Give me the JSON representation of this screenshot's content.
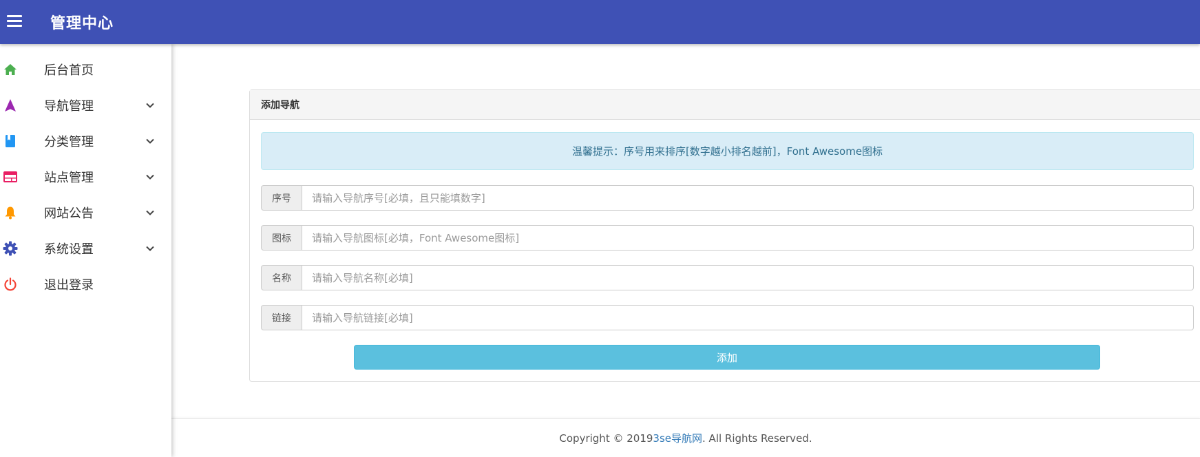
{
  "header": {
    "title": "管理中心",
    "menu_icon": "hamburger-icon",
    "bg_color": "#3f51b5"
  },
  "sidebar": {
    "items": [
      {
        "label": "后台首页",
        "icon": "home-icon",
        "icon_color": "#4caf50",
        "has_chevron": false
      },
      {
        "label": "导航管理",
        "icon": "navigation-arrow-icon",
        "icon_color": "#9c27b0",
        "has_chevron": true
      },
      {
        "label": "分类管理",
        "icon": "book-icon",
        "icon_color": "#2196f3",
        "has_chevron": true
      },
      {
        "label": "站点管理",
        "icon": "web-window-icon",
        "icon_color": "#e91e63",
        "has_chevron": true
      },
      {
        "label": "网站公告",
        "icon": "bell-icon",
        "icon_color": "#ff9800",
        "has_chevron": true
      },
      {
        "label": "系统设置",
        "icon": "gear-icon",
        "icon_color": "#3f51b5",
        "has_chevron": true
      },
      {
        "label": "退出登录",
        "icon": "power-icon",
        "icon_color": "#f44336",
        "has_chevron": false
      }
    ]
  },
  "card": {
    "title": "添加导航",
    "alert": "温馨提示：序号用来排序[数字越小排名越前]，Font Awesome图标",
    "fields": [
      {
        "label": "序号",
        "placeholder": "请输入导航序号[必填，且只能填数字]",
        "value": ""
      },
      {
        "label": "图标",
        "placeholder": "请输入导航图标[必填，Font Awesome图标]",
        "value": ""
      },
      {
        "label": "名称",
        "placeholder": "请输入导航名称[必填]",
        "value": ""
      },
      {
        "label": "链接",
        "placeholder": "请输入导航链接[必填]",
        "value": ""
      }
    ],
    "submit_label": "添加"
  },
  "footer": {
    "prefix": "Copyright © 2019 ",
    "link_text": "3se导航网",
    "suffix": ". All Rights Reserved."
  }
}
